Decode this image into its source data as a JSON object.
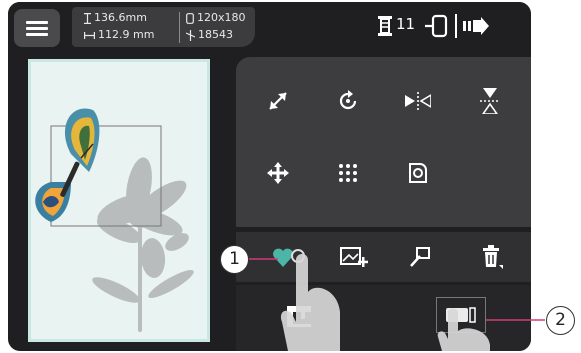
{
  "topbar": {
    "menu_icon": "hamburger-icon",
    "height_value": "136.6mm",
    "width_value": "112.9 mm",
    "hoop_size": "120x180",
    "stitch_count": "18543",
    "thread_count": "11",
    "icons": [
      "thread-spool-icon",
      "hoop-icon",
      "next-arrow-icon"
    ]
  },
  "tools": {
    "row1": [
      "resize-icon",
      "rotate-icon",
      "mirror-horizontal-icon",
      "mirror-vertical-icon"
    ],
    "row2": [
      "move-icon",
      "stitch-grid-icon",
      "applique-icon"
    ]
  },
  "bottom_row": [
    "favorite-icon",
    "add-image-icon",
    "pin-icon",
    "delete-icon"
  ],
  "callouts": {
    "one": "1",
    "two": "2"
  },
  "colors": {
    "screen_bg": "#1f1f21",
    "panel_bg": "#3d3d40",
    "canvas_bg": "#e9f3f1",
    "accent_heart": "#4bb6a8",
    "callout_line": "#d13b7a"
  }
}
